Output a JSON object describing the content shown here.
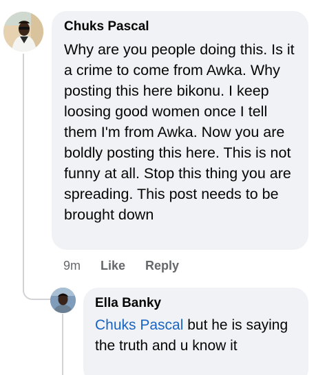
{
  "comment": {
    "author": "Chuks Pascal",
    "text": "Why are you people doing this. Is it a crime to come from Awka. Why posting this here bikonu. I keep loosing good women once I tell them I'm from Awka. Now you are boldly posting this here. This is not funny at all. Stop this thing you are spreading. This post needs to be brought down",
    "timestamp": "9m",
    "like_label": "Like",
    "reply_label": "Reply"
  },
  "reply": {
    "author": "Ella Banky",
    "mention": "Chuks Pascal",
    "text": " but he is saying the truth and u know it"
  },
  "colors": {
    "bubble_bg": "#f0f2f5",
    "mention": "#1864c2",
    "meta_text": "#65676b",
    "thread_line": "#d0d2d6"
  }
}
